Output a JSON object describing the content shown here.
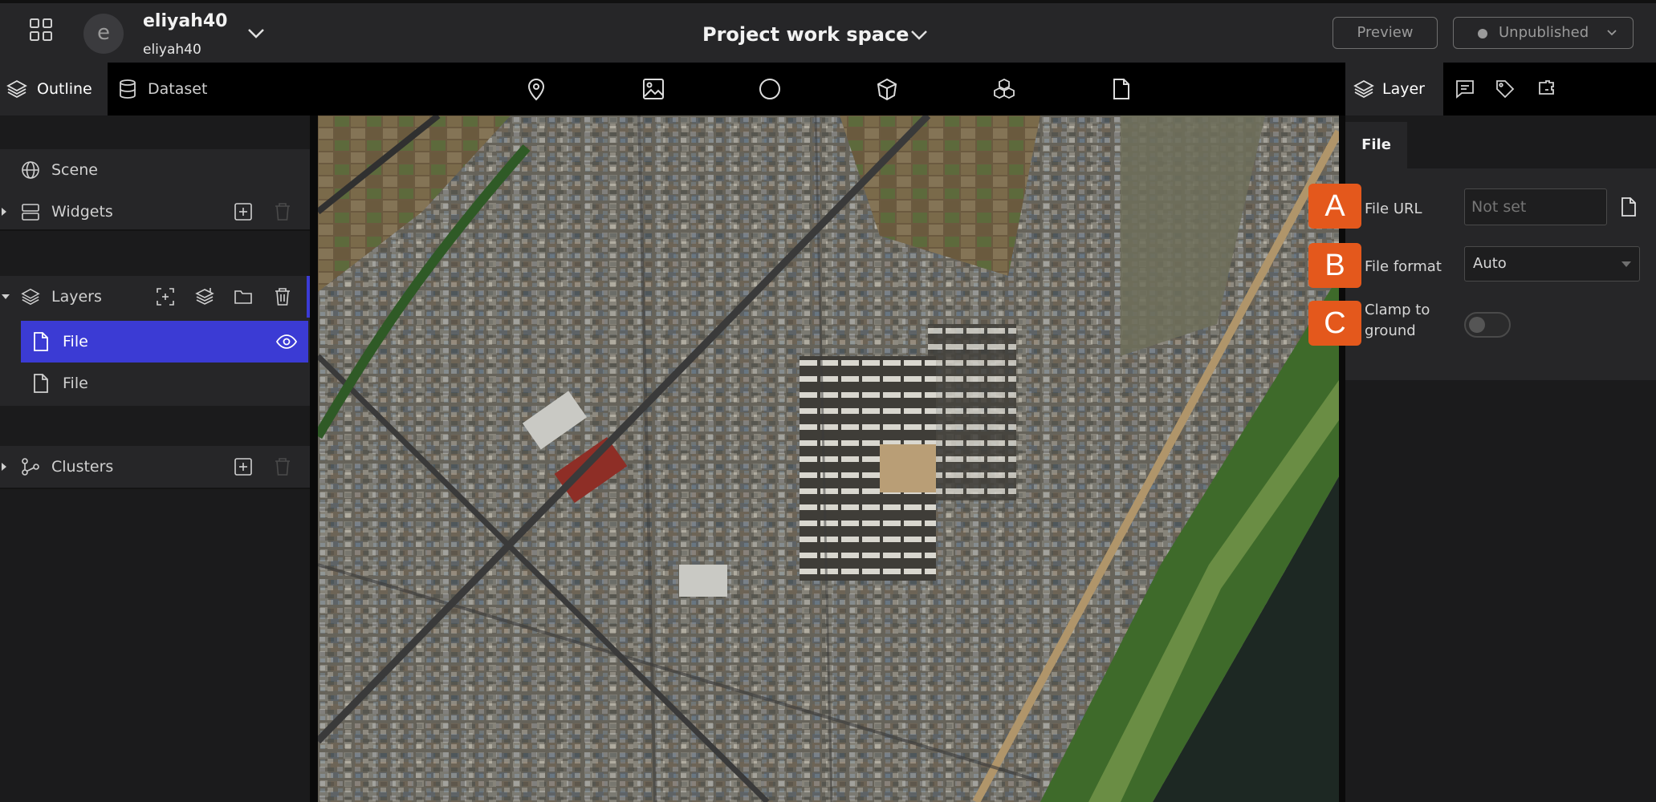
{
  "header": {
    "user_initial": "e",
    "user_name": "eliyah40",
    "user_sub": "eliyah40",
    "project_title": "Project work space",
    "preview_label": "Preview",
    "publish_label": "Unpublished"
  },
  "left_tabs": [
    {
      "label": "Outline",
      "icon": "layers-icon",
      "active": true
    },
    {
      "label": "Dataset",
      "icon": "database-icon",
      "active": false
    }
  ],
  "outline": {
    "scene_label": "Scene",
    "widgets_label": "Widgets",
    "layers_label": "Layers",
    "layer_items": [
      {
        "label": "File",
        "selected": true
      },
      {
        "label": "File",
        "selected": false
      }
    ],
    "clusters_label": "Clusters"
  },
  "toolbar_icons": [
    "map-pin-icon",
    "image-icon",
    "circle-icon",
    "box-3d-icon",
    "model-3d-icon",
    "file-icon"
  ],
  "right_tabs": [
    {
      "icon": "layer-icon",
      "label": "Layer",
      "active": true
    },
    {
      "icon": "infobox-icon",
      "label": "",
      "active": false
    },
    {
      "icon": "tag-icon",
      "label": "",
      "active": false
    },
    {
      "icon": "plugin-icon",
      "label": "",
      "active": false
    }
  ],
  "properties": {
    "section_title": "File",
    "markers": [
      "A",
      "B",
      "C"
    ],
    "file_url_label": "File URL",
    "file_url_placeholder": "Not set",
    "file_format_label": "File format",
    "file_format_value": "Auto",
    "clamp_label_line1": "Clamp to",
    "clamp_label_line2": "ground",
    "clamp_enabled": false
  },
  "colors": {
    "accent": "#3b3bd4",
    "marker": "#e4581c",
    "panel": "#262628"
  }
}
